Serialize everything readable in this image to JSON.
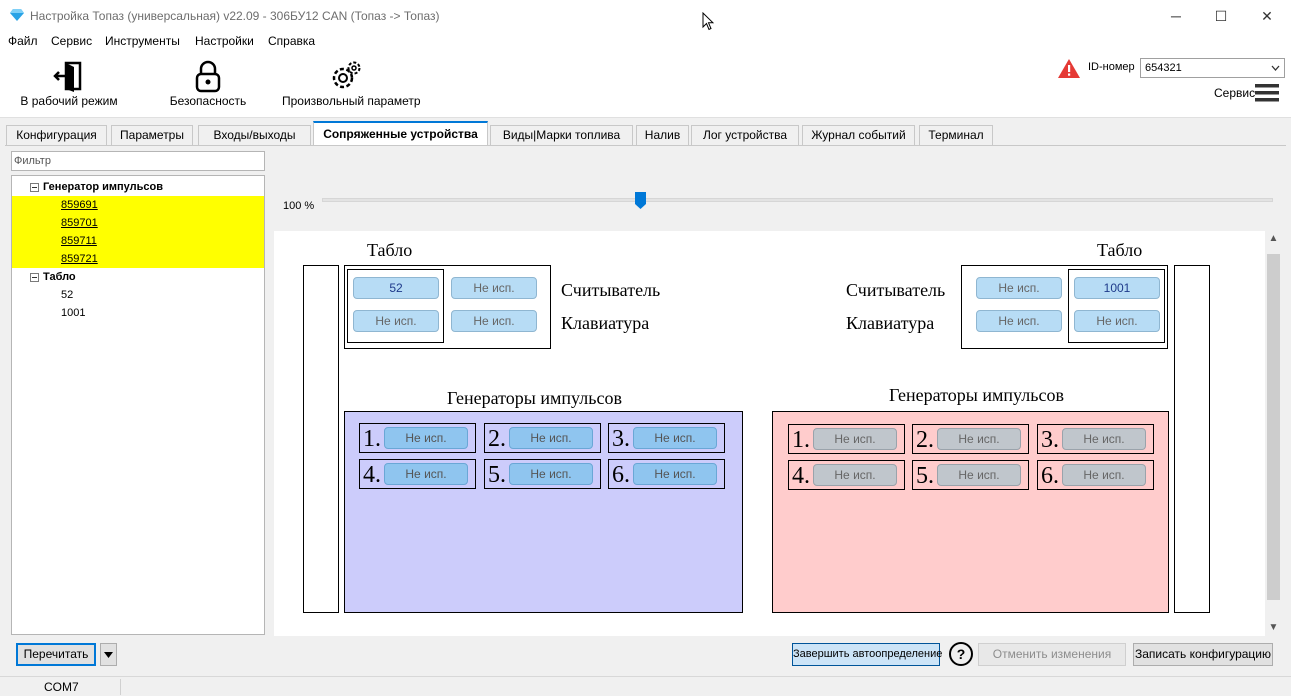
{
  "window": {
    "title": "Настройка Топаз (универсальная) v22.09 - 306БУ12 CAN (Топаз -> Топаз)",
    "minimize": "─",
    "maximize": "☐",
    "close": "✕"
  },
  "menu": [
    "Файл",
    "Сервис",
    "Инструменты",
    "Настройки",
    "Справка"
  ],
  "toolbar": {
    "work_mode": "В рабочий режим",
    "security": "Безопасность",
    "custom_param": "Произвольный параметр",
    "id_label": "ID-номер",
    "id_value": "654321",
    "service": "Сервис"
  },
  "tabs": [
    "Конфигурация",
    "Параметры",
    "Входы/выходы",
    "Сопряженные устройства",
    "Виды|Марки топлива",
    "Налив",
    "Лог устройства",
    "Журнал событий",
    "Терминал"
  ],
  "filter_placeholder": "Фильтр",
  "tree": {
    "group1": "Генератор импульсов",
    "group1_items": [
      "859691",
      "859701",
      "859711",
      "859721"
    ],
    "group2": "Табло",
    "group2_items": [
      "52",
      "1001"
    ]
  },
  "zoom": {
    "label": "100 %",
    "value_percent": 100
  },
  "diagram": {
    "left": {
      "tablo_title": "Табло",
      "reader_label": "Считыватель",
      "keyboard_label": "Клавиатура",
      "buttons": [
        "52",
        "Не исп.",
        "Не исп.",
        "Не исп."
      ],
      "gen_title": "Генераторы импульсов",
      "gens": [
        {
          "num": "1.",
          "label": "Не исп."
        },
        {
          "num": "2.",
          "label": "Не исп."
        },
        {
          "num": "3.",
          "label": "Не исп."
        },
        {
          "num": "4.",
          "label": "Не исп."
        },
        {
          "num": "5.",
          "label": "Не исп."
        },
        {
          "num": "6.",
          "label": "Не исп."
        }
      ]
    },
    "right": {
      "tablo_title": "Табло",
      "reader_label": "Считыватель",
      "keyboard_label": "Клавиатура",
      "buttons": [
        "Не исп.",
        "1001",
        "Не исп.",
        "Не исп."
      ],
      "gen_title": "Генераторы импульсов",
      "gens": [
        {
          "num": "1.",
          "label": "Не исп."
        },
        {
          "num": "2.",
          "label": "Не исп."
        },
        {
          "num": "3.",
          "label": "Не исп."
        },
        {
          "num": "4.",
          "label": "Не исп."
        },
        {
          "num": "5.",
          "label": "Не исп."
        },
        {
          "num": "6.",
          "label": "Не исп."
        }
      ]
    },
    "colors": {
      "left_panel": "#ccccfb",
      "right_panel": "#ffcccc"
    }
  },
  "bottom": {
    "reread": "Перечитать",
    "finish_autodetect": "Завершить автоопределение",
    "help": "?",
    "cancel_changes": "Отменить изменения",
    "write_config": "Записать конфигурацию"
  },
  "status": {
    "port": "COM7"
  }
}
